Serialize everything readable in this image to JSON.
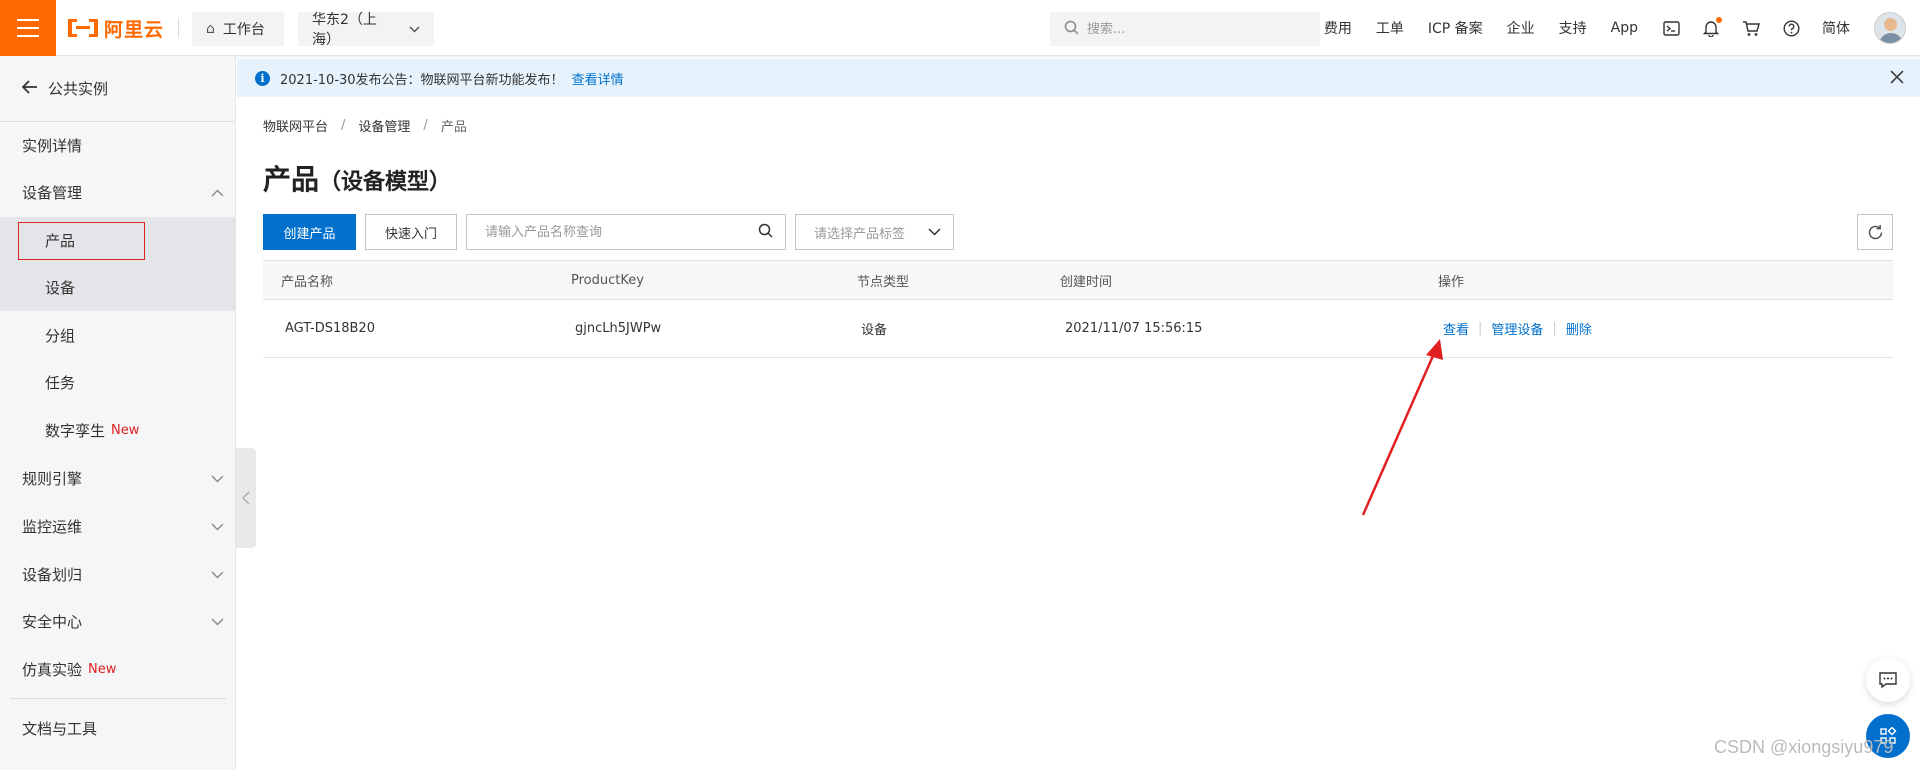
{
  "topbar": {
    "logo_text": "阿里云",
    "workbench_label": "工作台",
    "region_label": "华东2（上海）",
    "search_placeholder": "搜索...",
    "links": [
      "费用",
      "工单",
      "ICP 备案",
      "企业",
      "支持",
      "App"
    ],
    "language_label": "简体"
  },
  "sidebar": {
    "back_label": "公共实例",
    "items": [
      {
        "label": "实例详情"
      },
      {
        "label": "设备管理"
      },
      {
        "label": "产品"
      },
      {
        "label": "设备"
      },
      {
        "label": "分组"
      },
      {
        "label": "任务"
      },
      {
        "label": "数字孪生",
        "badge": "New"
      },
      {
        "label": "规则引擎"
      },
      {
        "label": "监控运维"
      },
      {
        "label": "设备划归"
      },
      {
        "label": "安全中心"
      },
      {
        "label": "仿真实验",
        "badge": "New"
      },
      {
        "label": "文档与工具"
      }
    ]
  },
  "notice": {
    "text": "2021-10-30发布公告：物联网平台新功能发布！",
    "link": "查看详情"
  },
  "breadcrumb": [
    "物联网平台",
    "设备管理",
    "产品"
  ],
  "page": {
    "title": "产品",
    "subtitle": "（设备模型）"
  },
  "toolbar": {
    "create_label": "创建产品",
    "quickstart_label": "快速入门",
    "search_placeholder": "请输入产品名称查询",
    "tag_placeholder": "请选择产品标签"
  },
  "table": {
    "columns": [
      "产品名称",
      "ProductKey",
      "节点类型",
      "创建时间",
      "操作"
    ],
    "rows": [
      {
        "name": "AGT-DS18B20",
        "product_key": "gjncLh5JWPw",
        "node_type": "设备",
        "created": "2021/11/07 15:56:15",
        "actions": [
          "查看",
          "管理设备",
          "删除"
        ]
      }
    ]
  },
  "watermark": "CSDN @xiongsiyu979",
  "colors": {
    "brand": "#ff6a00",
    "primary": "#0070cc",
    "highlight": "#e02020"
  }
}
